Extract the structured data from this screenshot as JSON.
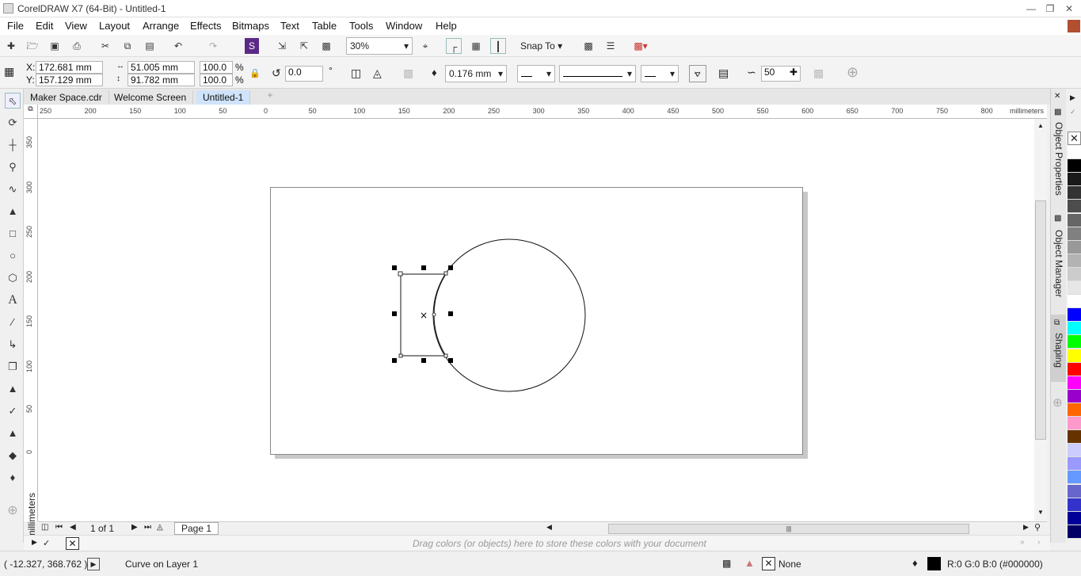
{
  "window": {
    "title": "CorelDRAW X7 (64-Bit) - Untitled-1"
  },
  "menu": [
    "File",
    "Edit",
    "View",
    "Layout",
    "Arrange",
    "Effects",
    "Bitmaps",
    "Text",
    "Table",
    "Tools",
    "Window",
    "Help"
  ],
  "standard_toolbar": {
    "zoom": "30%",
    "snap_to": "Snap To"
  },
  "property_bar": {
    "x_label": "X:",
    "x": "172.681 mm",
    "y_label": "Y:",
    "y": "157.129 mm",
    "width": "51.005 mm",
    "height": "91.782 mm",
    "scale_x": "100.0",
    "scale_y": "100.0",
    "pct": "%",
    "rotation": "0.0",
    "deg": "°",
    "outline_width": "0.176 mm",
    "smoothing": "50"
  },
  "tabs": [
    "Maker Space.cdr",
    "Welcome Screen",
    "Untitled-1"
  ],
  "active_tab": "Untitled-1",
  "rulers": {
    "h_ticks": [
      "250",
      "200",
      "150",
      "100",
      "50",
      "0",
      "50",
      "100",
      "150",
      "200",
      "250",
      "300",
      "350",
      "400",
      "450",
      "500",
      "550",
      "600",
      "650",
      "700",
      "750",
      "800"
    ],
    "v_ticks": [
      "350",
      "300",
      "250",
      "200",
      "150",
      "100",
      "50",
      "0"
    ],
    "unit": "millimeters"
  },
  "dockers": [
    "Object Properties",
    "Object Manager",
    "Shaping"
  ],
  "palette": [
    "#ffffff",
    "#000000",
    "#1a1a1a",
    "#333333",
    "#4d4d4d",
    "#666666",
    "#808080",
    "#999999",
    "#b3b3b3",
    "#cccccc",
    "#e6e6e6",
    "#ffffff",
    "#0000ff",
    "#00ffff",
    "#00ff00",
    "#ffff00",
    "#ff0000",
    "#ff00ff",
    "#9900cc",
    "#ff6600",
    "#ff99cc",
    "#663300",
    "#ccccff",
    "#9999ff",
    "#6699ff",
    "#6666cc",
    "#3333cc",
    "#000099",
    "#000066"
  ],
  "page_nav": {
    "page_of": "1 of 1",
    "page_tab": "Page 1"
  },
  "doc_palette": {
    "hint": "Drag colors (or objects) here to store these colors with your document"
  },
  "status": {
    "coords": "( -12.327, 368.762 )",
    "object": "Curve on Layer 1",
    "fill": "None",
    "outline_color": "R:0 G:0 B:0 (#000000)"
  }
}
